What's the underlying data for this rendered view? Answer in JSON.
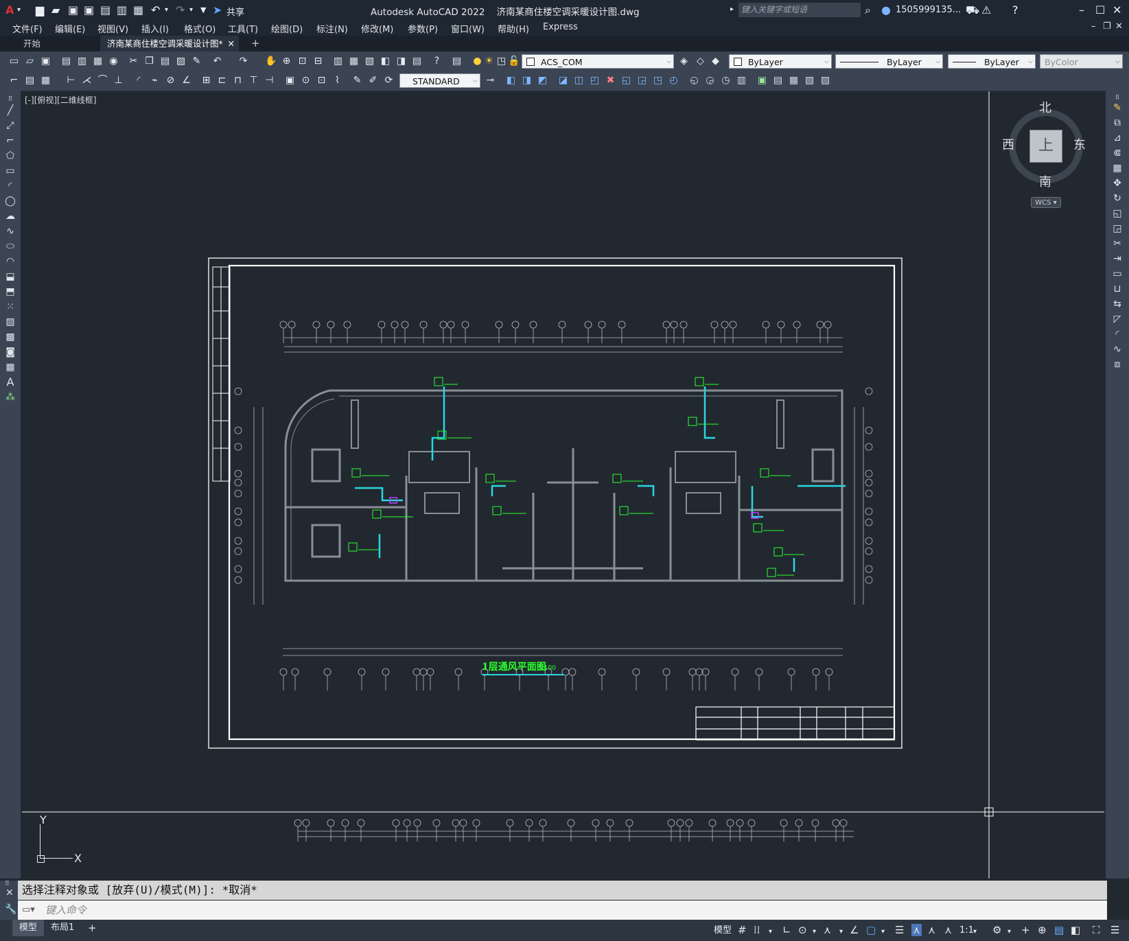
{
  "window": {
    "title": "Autodesk AutoCAD 2022",
    "document": "济南某商住楼空调采暖设计图.dwg",
    "share_label": "共享",
    "search_placeholder": "键入关键字或短语",
    "user": "1505999135...",
    "window_controls": [
      "minimize-icon",
      "maximize-icon",
      "close-icon"
    ]
  },
  "menu": {
    "items": [
      "文件(F)",
      "编辑(E)",
      "视图(V)",
      "插入(I)",
      "格式(O)",
      "工具(T)",
      "绘图(D)",
      "标注(N)",
      "修改(M)",
      "参数(P)",
      "窗口(W)",
      "帮助(H)",
      "Express"
    ]
  },
  "tabs": {
    "start": "开始",
    "active": "济南某商住楼空调采暖设计图*",
    "add": "+"
  },
  "properties": {
    "layer": "ACS_COM",
    "color": "ByLayer",
    "linetype": "ByLayer",
    "lineweight": "ByLayer",
    "plotstyle": "ByColor",
    "textstyle": "STANDARD"
  },
  "viewport": {
    "label": "[-][俯视][二维线框]"
  },
  "viewcube": {
    "north": "北",
    "south": "南",
    "east": "东",
    "west": "西",
    "face": "上",
    "wcs": "WCS"
  },
  "ucs": {
    "x": "X",
    "y": "Y"
  },
  "drawing": {
    "plan_title": "1层通风平面图",
    "scale": "1:100",
    "colors": {
      "walls": "#8a8f96",
      "annotation": "#2bff2b",
      "duct": "#2ad7e0",
      "frame": "#ffffff",
      "highlight": "#c040ff"
    }
  },
  "command": {
    "history": "选择注释对象或 [放弃(U)/模式(M)]: *取消*",
    "placeholder": "键入命令"
  },
  "status": {
    "model_tab": "模型",
    "layout_tab": "布局1",
    "add_tab": "+",
    "model_button": "模型",
    "annotation_scale": "1:1"
  }
}
